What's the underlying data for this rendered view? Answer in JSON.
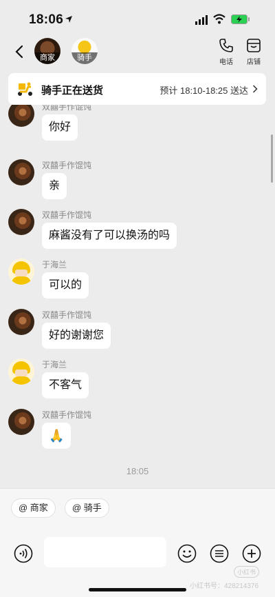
{
  "status": {
    "time": "18:06"
  },
  "header": {
    "merchant_tag": "商家",
    "rider_tag": "骑手",
    "phone_label": "电话",
    "store_label": "店铺"
  },
  "banner": {
    "title": "骑手正在送货",
    "eta": "预计 18:10-18:25 送达"
  },
  "messages": [
    {
      "sender": "双囍手作馄饨",
      "text": "你好",
      "avatar": "food"
    },
    {
      "sender": "双囍手作馄饨",
      "text": "亲",
      "avatar": "food"
    },
    {
      "sender": "双囍手作馄饨",
      "text": "麻酱没有了可以换汤的吗",
      "avatar": "food"
    },
    {
      "sender": "于海兰",
      "text": "可以的",
      "avatar": "rider"
    },
    {
      "sender": "双囍手作馄饨",
      "text": "好的谢谢您",
      "avatar": "food"
    },
    {
      "sender": "于海兰",
      "text": "不客气",
      "avatar": "rider"
    },
    {
      "sender": "双囍手作馄饨",
      "text": "🙏",
      "avatar": "food"
    }
  ],
  "time_separator": "18:05",
  "bottom": {
    "mention_merchant": "@ 商家",
    "mention_rider": "@ 骑手",
    "input_placeholder": ""
  },
  "watermark": "小红书号：428214376",
  "watermark_logo": "小红书"
}
